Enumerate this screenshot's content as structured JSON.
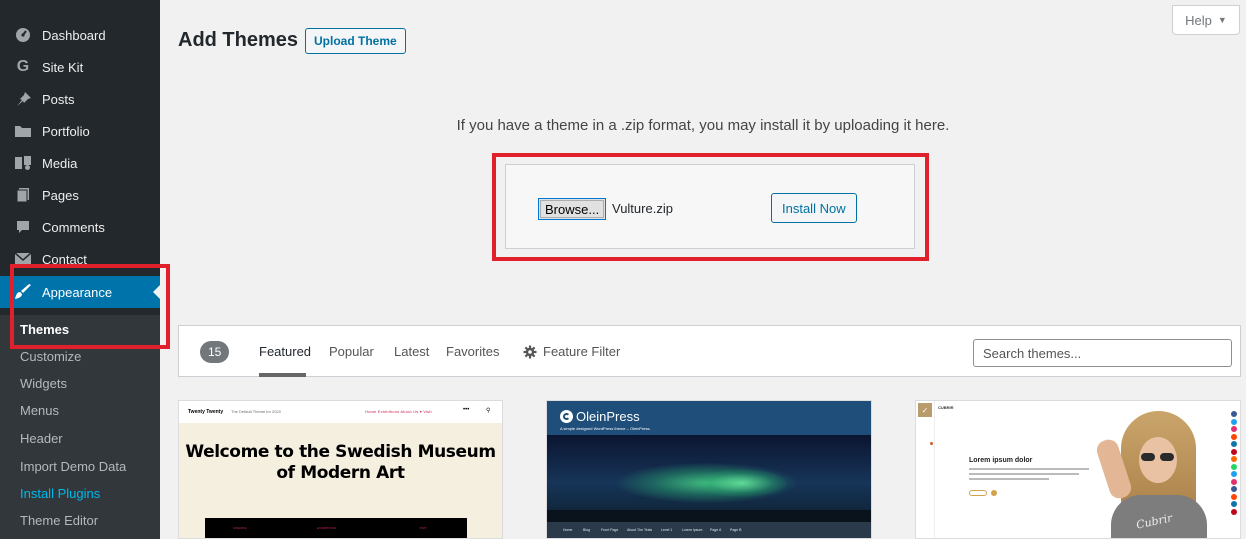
{
  "sidebar": {
    "items": [
      {
        "label": "Dashboard",
        "icon": "dashboard-icon"
      },
      {
        "label": "Site Kit",
        "icon": "google-g-icon"
      },
      {
        "label": "Posts",
        "icon": "pushpin-icon"
      },
      {
        "label": "Portfolio",
        "icon": "folder-icon"
      },
      {
        "label": "Media",
        "icon": "media-icon"
      },
      {
        "label": "Pages",
        "icon": "pages-icon"
      },
      {
        "label": "Comments",
        "icon": "comment-icon"
      },
      {
        "label": "Contact",
        "icon": "envelope-icon"
      },
      {
        "label": "Appearance",
        "icon": "paintbrush-icon"
      }
    ],
    "submenu": [
      {
        "label": "Themes"
      },
      {
        "label": "Customize"
      },
      {
        "label": "Widgets"
      },
      {
        "label": "Menus"
      },
      {
        "label": "Header"
      },
      {
        "label": "Import Demo Data"
      },
      {
        "label": "Install Plugins"
      },
      {
        "label": "Theme Editor"
      }
    ]
  },
  "header": {
    "title": "Add Themes",
    "upload_label": "Upload Theme",
    "help_label": "Help",
    "help_arrow": "▼"
  },
  "upload": {
    "help_text": "If you have a theme in a .zip format, you may install it by uploading it here.",
    "browse_label": "Browse...",
    "file_name": "Vulture.zip",
    "install_label": "Install Now"
  },
  "filter": {
    "count": "15",
    "tabs": [
      {
        "label": "Featured"
      },
      {
        "label": "Popular"
      },
      {
        "label": "Latest"
      },
      {
        "label": "Favorites"
      }
    ],
    "feature_filter_label": "Feature Filter",
    "search_placeholder": "Search themes..."
  },
  "themes": [
    {
      "name": "Twenty Twenty",
      "tagline": "The Default Theme for 2020",
      "nav_links": "Home   Exhibitions   About Us ▾   Visit",
      "headline": "Welcome to the Swedish Museum of Modern Art",
      "strip": [
        "OPENING",
        "EXHIBITIONS",
        "VISIT"
      ]
    },
    {
      "name": "OleinPress",
      "tagline": "A simple designed WordPress theme – OleinPress.",
      "menu": [
        "Home",
        "Blog",
        "Front Page",
        "About The Tests",
        "Level 1",
        "Lorem Ipsum",
        "Page A",
        "Page B"
      ]
    },
    {
      "name": "CUBRIR",
      "headline": "Lorem ipsum dolor",
      "shirt_text": "Cubrir"
    }
  ],
  "colors": {
    "sidebar_bg": "#23282d",
    "submenu_bg": "#32373c",
    "accent": "#0073aa",
    "highlight_link": "#00b9eb",
    "annotation_red": "#e0202a"
  }
}
